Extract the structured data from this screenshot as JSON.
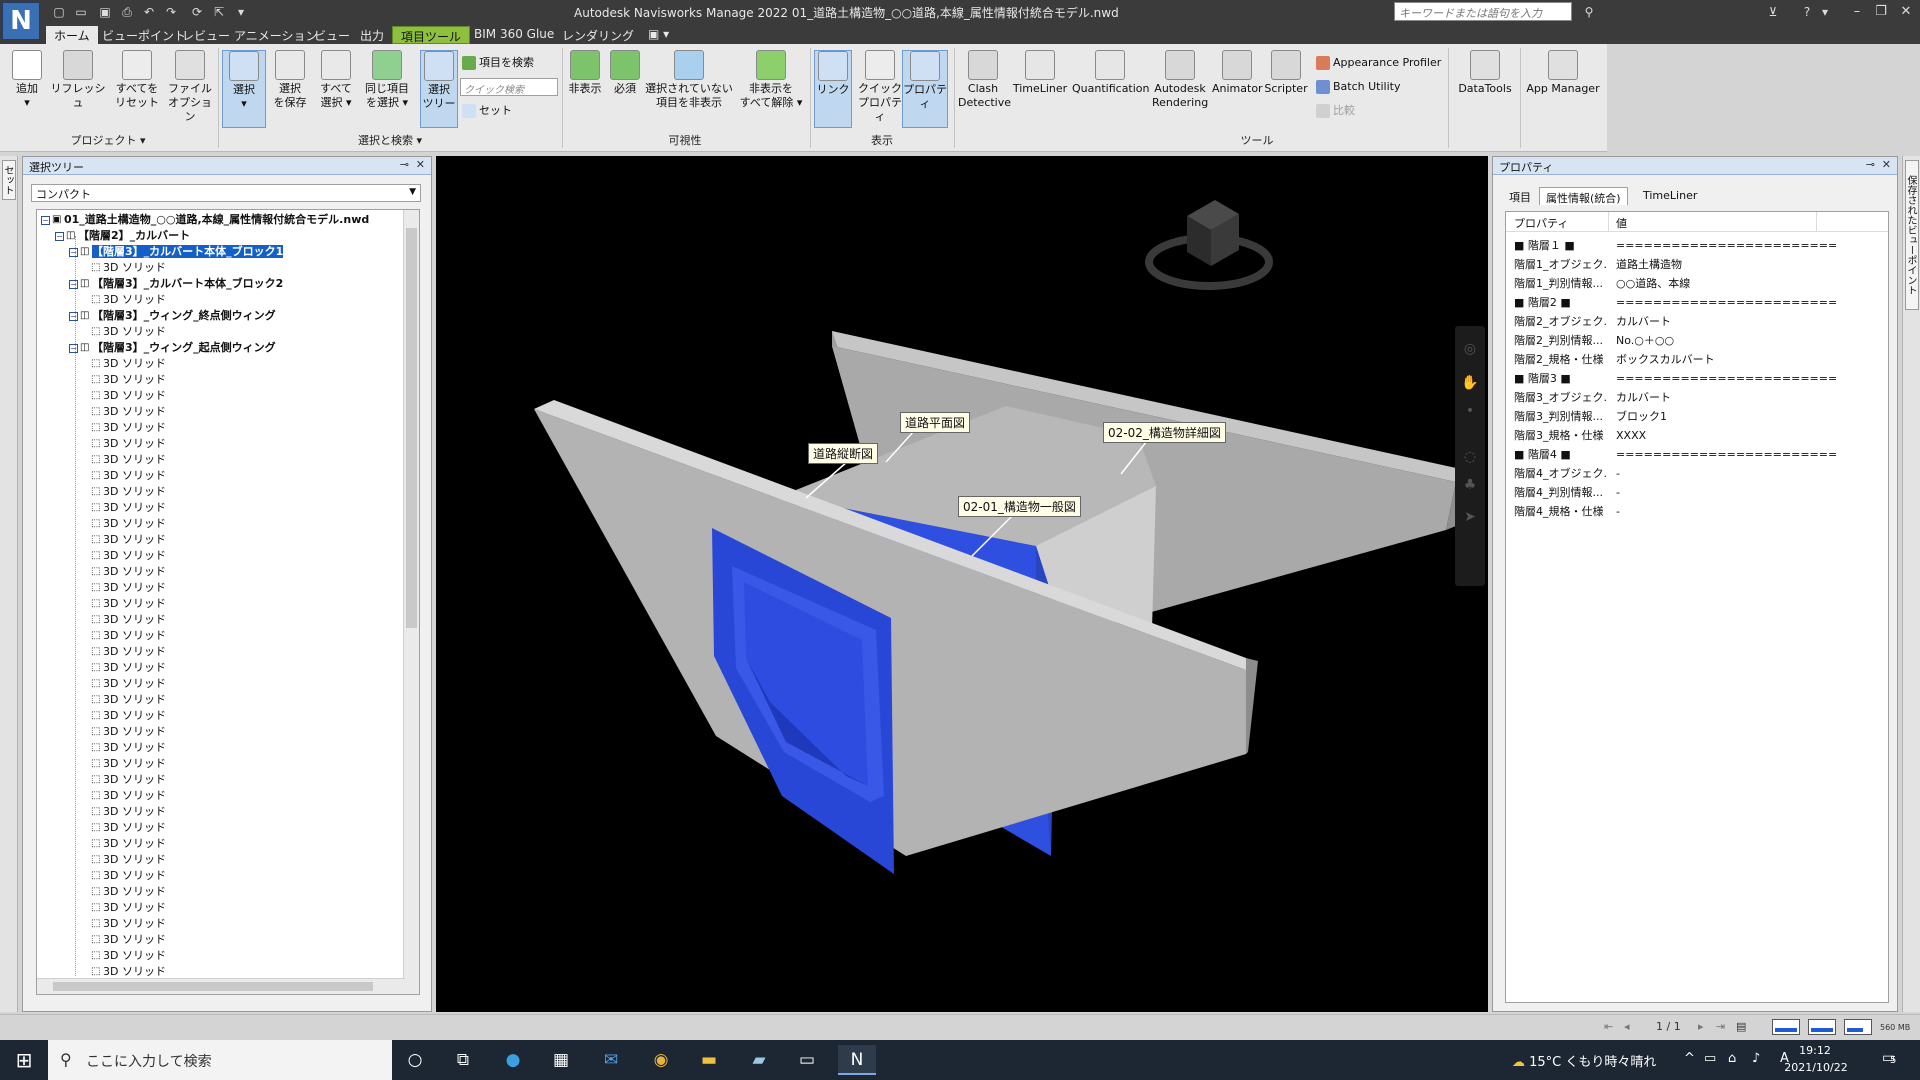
{
  "window": {
    "title": "Autodesk Navisworks Manage 2022   01_道路土構造物_○○道路,本線_属性情報付統合モデル.nwd",
    "app_logo": "N",
    "search_placeholder": "キーワードまたは語句を入力",
    "controls": {
      "minimize": "–",
      "restore": "❐",
      "close": "✕"
    }
  },
  "tabs": [
    {
      "label": "ホーム",
      "state": "active"
    },
    {
      "label": "ビューポイント",
      "state": "normal"
    },
    {
      "label": "レビュー",
      "state": "normal"
    },
    {
      "label": "アニメーション",
      "state": "normal"
    },
    {
      "label": "ビュー",
      "state": "normal"
    },
    {
      "label": "出力",
      "state": "normal"
    },
    {
      "label": "項目ツール",
      "state": "context"
    },
    {
      "label": "BIM 360 Glue",
      "state": "normal"
    },
    {
      "label": "レンダリング",
      "state": "normal"
    }
  ],
  "ribbon": {
    "project": {
      "label": "プロジェクト ▾",
      "buttons": [
        {
          "label": "追加\n▾",
          "icon": "file-add-icon"
        },
        {
          "label": "リフレッシュ",
          "icon": "refresh-icon"
        },
        {
          "label": "すべてを\nリセット",
          "icon": "reset-all-icon"
        },
        {
          "label": "ファイル\nオプション",
          "icon": "file-options-icon"
        }
      ]
    },
    "select": {
      "label": "選択と検索 ▾",
      "buttons": [
        {
          "label": "選択\n▾",
          "icon": "cursor-select-icon"
        },
        {
          "label": "選択\nを保存",
          "icon": "save-selection-icon"
        },
        {
          "label": "すべて\n選択 ▾",
          "icon": "select-all-icon"
        },
        {
          "label": "同じ項目\nを選択 ▾",
          "icon": "select-same-icon"
        },
        {
          "label": "選択\nツリー",
          "icon": "selection-tree-icon"
        }
      ],
      "find_items": "項目を検索",
      "quick_find_placeholder": "クイック検索",
      "sets": "セット"
    },
    "visibility": {
      "label": "可視性",
      "buttons": [
        {
          "label": "非表示",
          "icon": "hide-icon"
        },
        {
          "label": "必須",
          "icon": "require-icon"
        },
        {
          "label": "選択されていない\n項目を非表示",
          "icon": "hide-unselected-icon"
        },
        {
          "label": "非表示を\nすべて解除 ▾",
          "icon": "unhide-all-icon"
        }
      ]
    },
    "display": {
      "label": "表示",
      "buttons": [
        {
          "label": "リンク",
          "icon": "link-icon"
        },
        {
          "label": "クイック\nプロパティ",
          "icon": "quick-properties-icon"
        },
        {
          "label": "プロパティ",
          "icon": "properties-icon"
        }
      ]
    },
    "tools": {
      "label": "ツール",
      "buttons": [
        {
          "label": "Clash\nDetective",
          "icon": "clash-detective-icon"
        },
        {
          "label": "TimeLiner",
          "icon": "timeliner-icon"
        },
        {
          "label": "Quantification",
          "icon": "quantification-icon"
        },
        {
          "label": "Autodesk\nRendering",
          "icon": "autodesk-rendering-icon"
        },
        {
          "label": "Animator",
          "icon": "animator-icon"
        },
        {
          "label": "Scripter",
          "icon": "scripter-icon"
        }
      ],
      "small": [
        "Appearance Profiler",
        "Batch Utility",
        "比較"
      ]
    },
    "extras": [
      {
        "label": "DataTools",
        "icon": "datatools-icon"
      },
      {
        "label": "App Manager",
        "icon": "app-manager-icon"
      }
    ]
  },
  "left_side_tab": "セット",
  "selection_tree": {
    "title": "選択ツリー",
    "mode": "コンパクト",
    "root": "01_道路土構造物_○○道路,本線_属性情報付統合モデル.nwd",
    "level2": "【階層2】_カルバート",
    "blocks": [
      {
        "label": "【階層3】_カルバート本体_ブロック1",
        "selected": true
      },
      {
        "label": "【階層3】_カルバート本体_ブロック2",
        "selected": false
      },
      {
        "label": "【階層3】_ウィング_終点側ウィング",
        "selected": false
      },
      {
        "label": "【階層3】_ウィング_起点側ウィング",
        "selected": false
      }
    ],
    "solid_label": "3D ソリッド",
    "solids_under_last": 39
  },
  "viewport": {
    "callouts": [
      "道路平面図",
      "道路縦断図",
      "02-02_構造物詳細図",
      "02-01_構造物一般図"
    ]
  },
  "properties": {
    "title": "プロパティ",
    "tabs": [
      "項目",
      "属性情報(統合)",
      "TimeLiner"
    ],
    "active_tab": 1,
    "col_property": "プロパティ",
    "col_value": "値",
    "rows": [
      {
        "k": "■ 階層１ ■",
        "v": "========================"
      },
      {
        "k": "階層1_オブジェク...",
        "v": "道路土構造物"
      },
      {
        "k": "階層1_判別情報...",
        "v": "○○道路、本線"
      },
      {
        "k": "■ 階層2 ■",
        "v": "========================"
      },
      {
        "k": "階層2_オブジェク...",
        "v": "カルバート"
      },
      {
        "k": "階層2_判別情報...",
        "v": "No.○＋○○"
      },
      {
        "k": "階層2_規格・仕様",
        "v": "ボックスカルバート"
      },
      {
        "k": "■ 階層3 ■",
        "v": "========================"
      },
      {
        "k": "階層3_オブジェク...",
        "v": "カルバート"
      },
      {
        "k": "階層3_判別情報...",
        "v": "ブロック1"
      },
      {
        "k": "階層3_規格・仕様",
        "v": "XXXX"
      },
      {
        "k": "■ 階層4 ■",
        "v": "========================"
      },
      {
        "k": "階層4_オブジェク...",
        "v": "-"
      },
      {
        "k": "階層4_判別情報...",
        "v": "-"
      },
      {
        "k": "階層4_規格・仕様",
        "v": "-"
      }
    ]
  },
  "right_side_tab": "保存されたビューポイント",
  "status": {
    "page": "1 / 1",
    "memory": "560 MB"
  },
  "taskbar": {
    "search_placeholder": "ここに入力して検索",
    "weather": "15°C  くもり時々晴れ",
    "ime": "A",
    "time": "19:12",
    "date": "2021/10/22",
    "notifications": "5"
  },
  "colors": {
    "accent_blue": "#1560c8",
    "concrete_light": "#c8c8c8",
    "culvert_blue": "#2f4fe0",
    "context_tab": "#8fbf3f"
  }
}
